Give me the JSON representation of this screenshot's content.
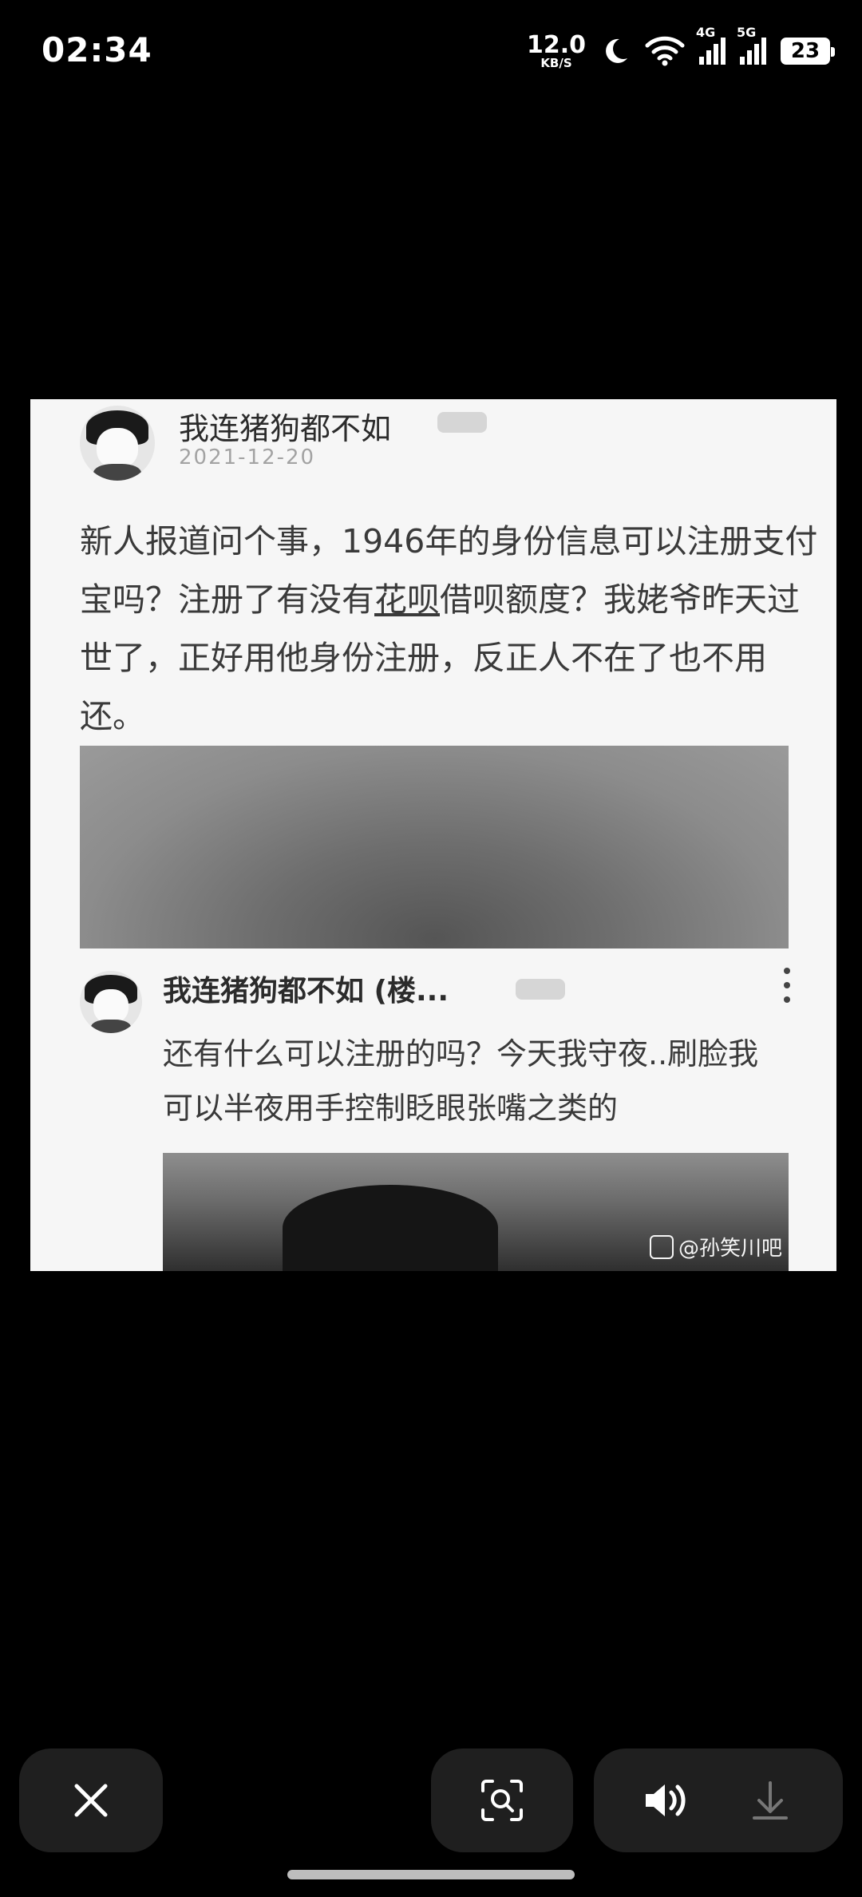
{
  "status_bar": {
    "time": "02:34",
    "net_speed_value": "12.0",
    "net_speed_unit": "KB/S",
    "signal_1_tag": "4G",
    "signal_2_tag": "5G",
    "battery": "23"
  },
  "post": {
    "username": "我连猪狗都不如",
    "date": "2021-12-20",
    "text_before_link": "新人报道问个事，1946年的身份信息可以注册支付宝吗？注册了有没有",
    "text_link": "花呗",
    "text_after_link": "借呗额度？我姥爷昨天过世了，正好用他身份注册，反正人不在了也不用还。"
  },
  "reply": {
    "username": "我连猪狗都不如 (楼...",
    "text": "还有什么可以注册的吗？今天我守夜..刷脸我可以半夜用手控制眨眼张嘴之类的"
  },
  "watermark": "@孙笑川吧"
}
